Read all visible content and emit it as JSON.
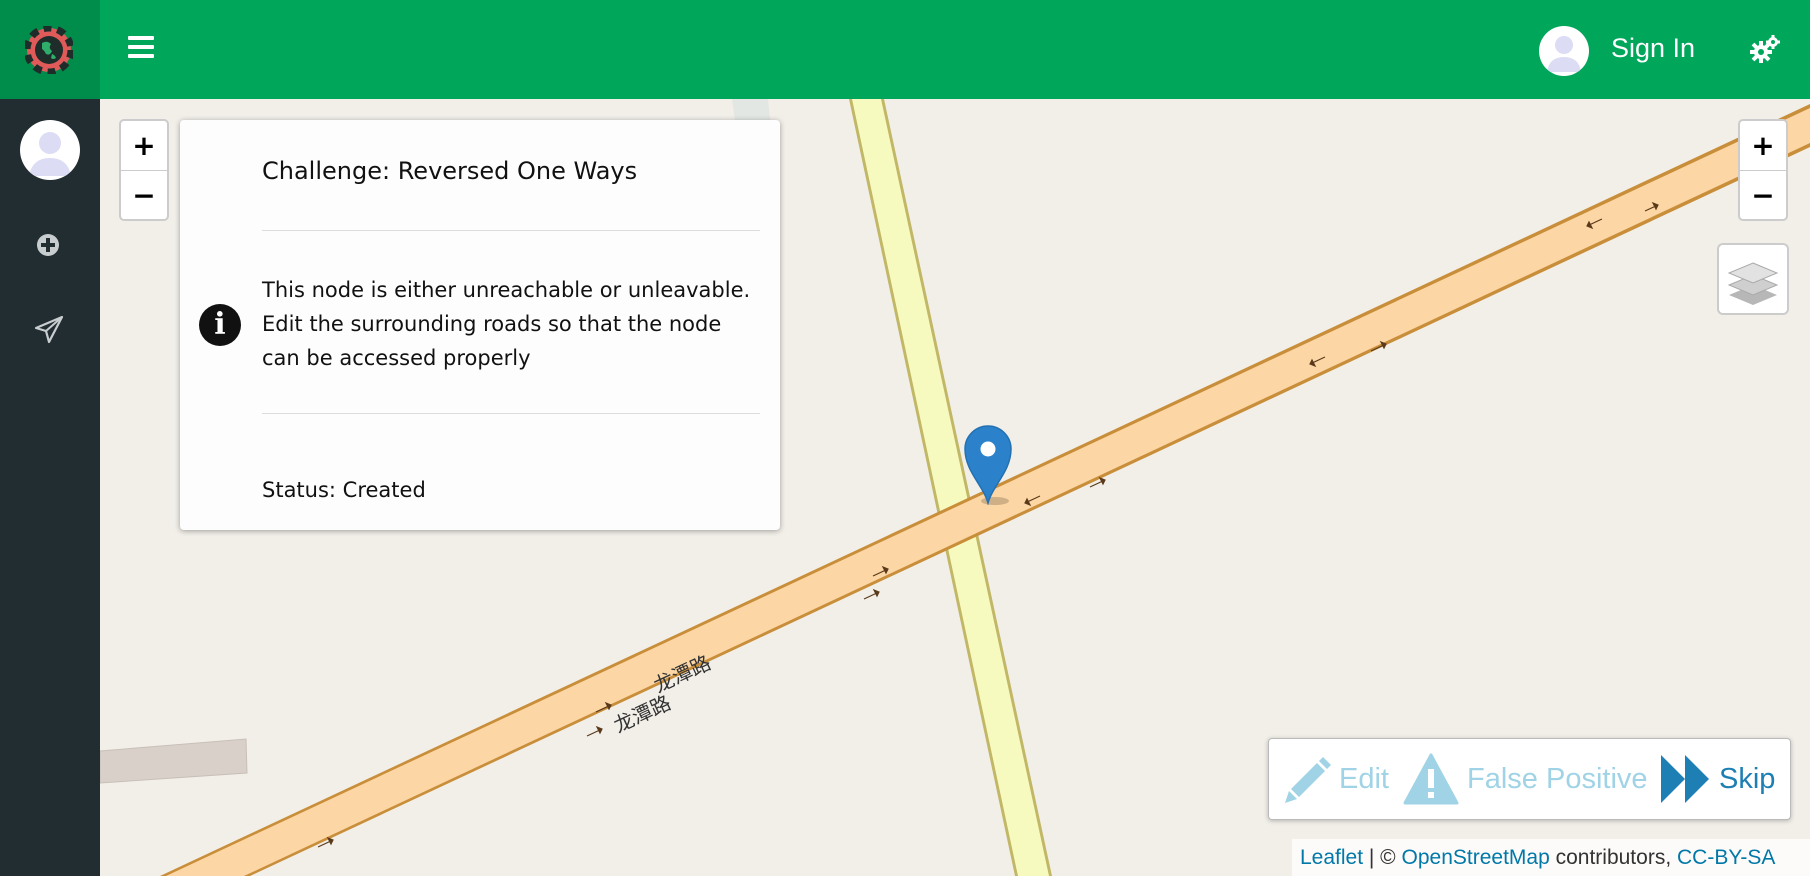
{
  "header": {
    "sign_in_label": "Sign In",
    "menu_icon": "hamburger-icon",
    "settings_icon": "gears-icon",
    "brand_color": "#00a65a"
  },
  "sidebar": {
    "items": [
      {
        "icon": "plus-circle-icon"
      },
      {
        "icon": "paper-plane-icon"
      }
    ],
    "bg_color": "#222d32"
  },
  "challenge_panel": {
    "title": "Challenge: Reversed One Ways",
    "description": "This node is either unreachable or unleavable. Edit the surrounding roads so that the node can be accessed properly",
    "status": "Status: Created"
  },
  "map": {
    "zoom_in_label": "+",
    "zoom_out_label": "−",
    "road_labels": [
      "龙潭路",
      "龙潭路"
    ]
  },
  "actions": {
    "edit_label": "Edit",
    "false_positive_label": "False Positive",
    "skip_label": "Skip"
  },
  "attribution": {
    "leaflet": "Leaflet",
    "separator": " | © ",
    "osm": "OpenStreetMap",
    "contributors": " contributors, ",
    "license": "CC-BY-SA"
  }
}
